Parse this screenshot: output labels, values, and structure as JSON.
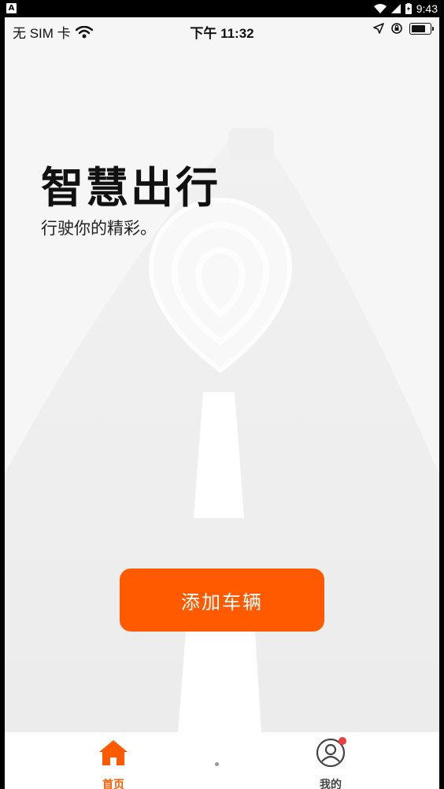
{
  "android_status": {
    "badge_letter": "A",
    "time": "9:43"
  },
  "ios_status": {
    "carrier": "无 SIM 卡",
    "time": "下午 11:32"
  },
  "hero": {
    "title": "智慧出行",
    "subtitle": "行驶你的精彩。"
  },
  "actions": {
    "add_vehicle": "添加车辆"
  },
  "tabbar": {
    "items": [
      {
        "label": "首页",
        "icon": "home-icon",
        "active": true
      },
      {
        "label": "我的",
        "icon": "user-icon",
        "active": false,
        "badge": true
      }
    ]
  },
  "colors": {
    "accent": "#ff5a00",
    "badge": "#f03c3c",
    "background": "#f6f6f6"
  }
}
